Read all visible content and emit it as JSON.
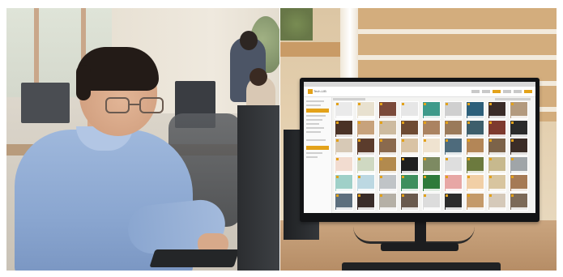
{
  "scene": {
    "left_panel": "",
    "right_panel": ""
  },
  "monitor_app": {
    "logo_text": "Tech-LIB",
    "accent_color": "#e3a21a",
    "grid": {
      "rows": 6,
      "cols": 9,
      "tile_colors": [
        [
          "#eaeaea",
          "#e8e1cf",
          "#7b4a3a",
          "#e6e6e6",
          "#3e9a8a",
          "#cfcfcf",
          "#2d5f7a",
          "#3a2c28",
          "#b39a7e"
        ],
        [
          "#4a3226",
          "#c7a27c",
          "#cdbba0",
          "#6e4b33",
          "#ab8361",
          "#9a7a5a",
          "#3d5e6b",
          "#7e3a2e",
          "#2b2b2b"
        ],
        [
          "#d7c9b6",
          "#5b3c2c",
          "#8a6a4e",
          "#d9c3a4",
          "#efe3d0",
          "#4e6b7c",
          "#b38657",
          "#7c6349",
          "#3b2d27"
        ],
        [
          "#f2dcd0",
          "#cfd9c2",
          "#b28a4e",
          "#1f1f1f",
          "#7d8a62",
          "#dedede",
          "#6c7a3e",
          "#c7b98e",
          "#a0a5a8"
        ],
        [
          "#9fd0c8",
          "#bcd8e2",
          "#c0c4c7",
          "#3e8f5e",
          "#2e7a3a",
          "#e7a7a5",
          "#f1cfa6",
          "#d8c59f",
          "#a57a55"
        ],
        [
          "#5d6f7e",
          "#3a2d2a",
          "#b5b0a6",
          "#6a5a4e",
          "#dcdcdc",
          "#2c2c2c",
          "#c49a6a",
          "#d5c9b9",
          "#7c6a58"
        ]
      ]
    }
  }
}
